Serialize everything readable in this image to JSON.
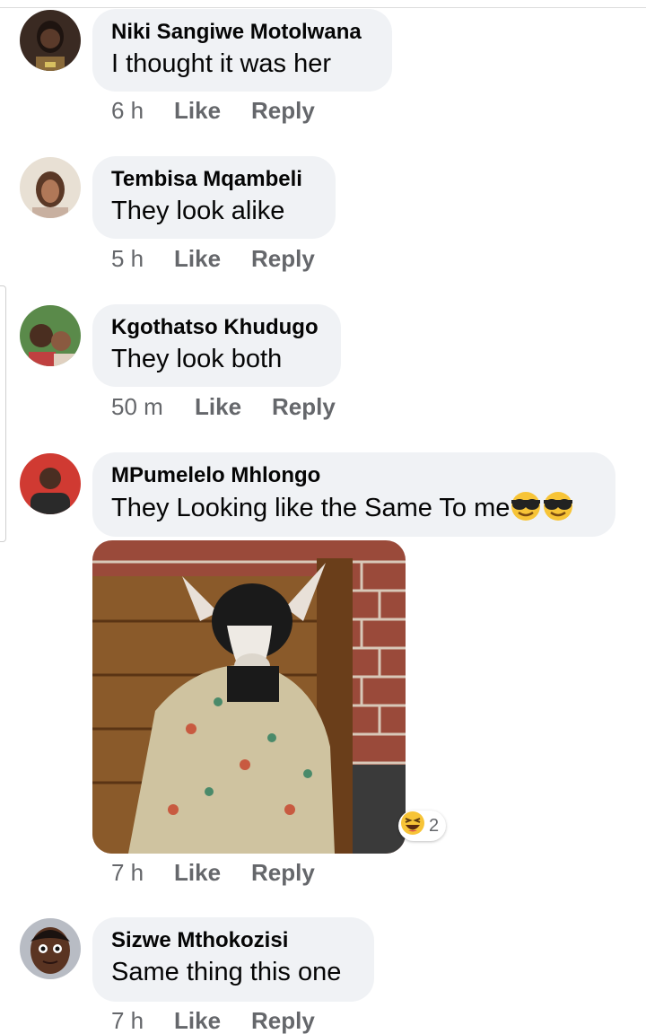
{
  "comments": [
    {
      "name": "Niki Sangiwe Motolwana",
      "text": "I thought it was her",
      "time": "6 h",
      "like": "Like",
      "reply": "Reply",
      "avatar_icon": "avatar-photo"
    },
    {
      "name": "Tembisa Mqambeli",
      "text": "They look alike",
      "time": "5 h",
      "like": "Like",
      "reply": "Reply",
      "avatar_icon": "avatar-photo"
    },
    {
      "name": "Kgothatso Khudugo",
      "text": "They look both",
      "time": "50 m",
      "like": "Like",
      "reply": "Reply",
      "avatar_icon": "avatar-photo"
    },
    {
      "name": "MPumelelo Mhlongo",
      "text": "They Looking like the Same To me",
      "time": "7 h",
      "like": "Like",
      "reply": "Reply",
      "avatar_icon": "avatar-photo",
      "emoji": "sunglasses-emoji",
      "reaction_icon": "laughing-emoji",
      "reaction_count": "2"
    },
    {
      "name": "Sizwe Mthokozisi",
      "text": "Same thing this one",
      "time": "7 h",
      "like": "Like",
      "reply": "Reply",
      "avatar_icon": "avatar-cartoon"
    }
  ],
  "colors": {
    "bubble": "#f0f2f5",
    "meta": "#65676b",
    "name": "#050505"
  }
}
